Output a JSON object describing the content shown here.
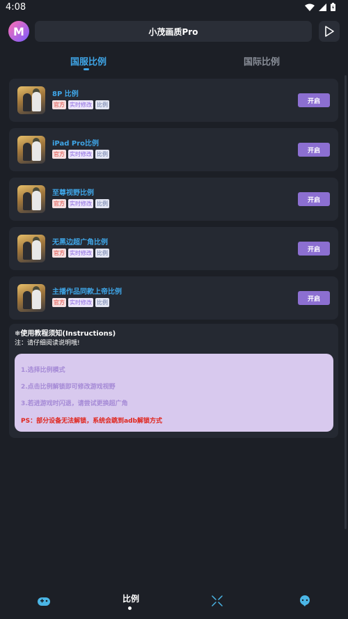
{
  "status_bar": {
    "time": "4:08"
  },
  "header": {
    "logo_text": "M",
    "title": "小茂画质Pro"
  },
  "tabs": [
    {
      "label": "国服比例",
      "active": true
    },
    {
      "label": "国际比例",
      "active": false
    }
  ],
  "cards": [
    {
      "title": "8P 比例",
      "tags": [
        "官方",
        "实时修改",
        "比例"
      ],
      "button": "开启"
    },
    {
      "title": "iPad Pro比例",
      "tags": [
        "官方",
        "实时修改",
        "比例"
      ],
      "button": "开启"
    },
    {
      "title": "至尊视野比例",
      "tags": [
        "官方",
        "实时修改",
        "比例"
      ],
      "button": "开启"
    },
    {
      "title": "无黑边超广角比例",
      "tags": [
        "官方",
        "实时修改",
        "比例"
      ],
      "button": "开启"
    },
    {
      "title": "主播作品同款上帝比例",
      "tags": [
        "官方",
        "实时修改",
        "比例"
      ],
      "button": "开启"
    }
  ],
  "instructions": {
    "title": "❄使用教程须知(Instructions)",
    "note": "注：请仔细阅读说明哦!",
    "steps": [
      "1.选择比例模式",
      "2.点击比例解锁即可修改游戏视野",
      "3.若进游戏时闪退，请尝试更换超广角"
    ],
    "ps": "PS：部分设备无法解锁，系统会跳到adb解锁方式"
  },
  "bottom_nav": {
    "items": [
      {
        "icon": "gamepad-icon"
      },
      {
        "label": "比例"
      },
      {
        "icon": "expand-arrows-icon"
      },
      {
        "icon": "chat-bot-icon"
      }
    ]
  }
}
